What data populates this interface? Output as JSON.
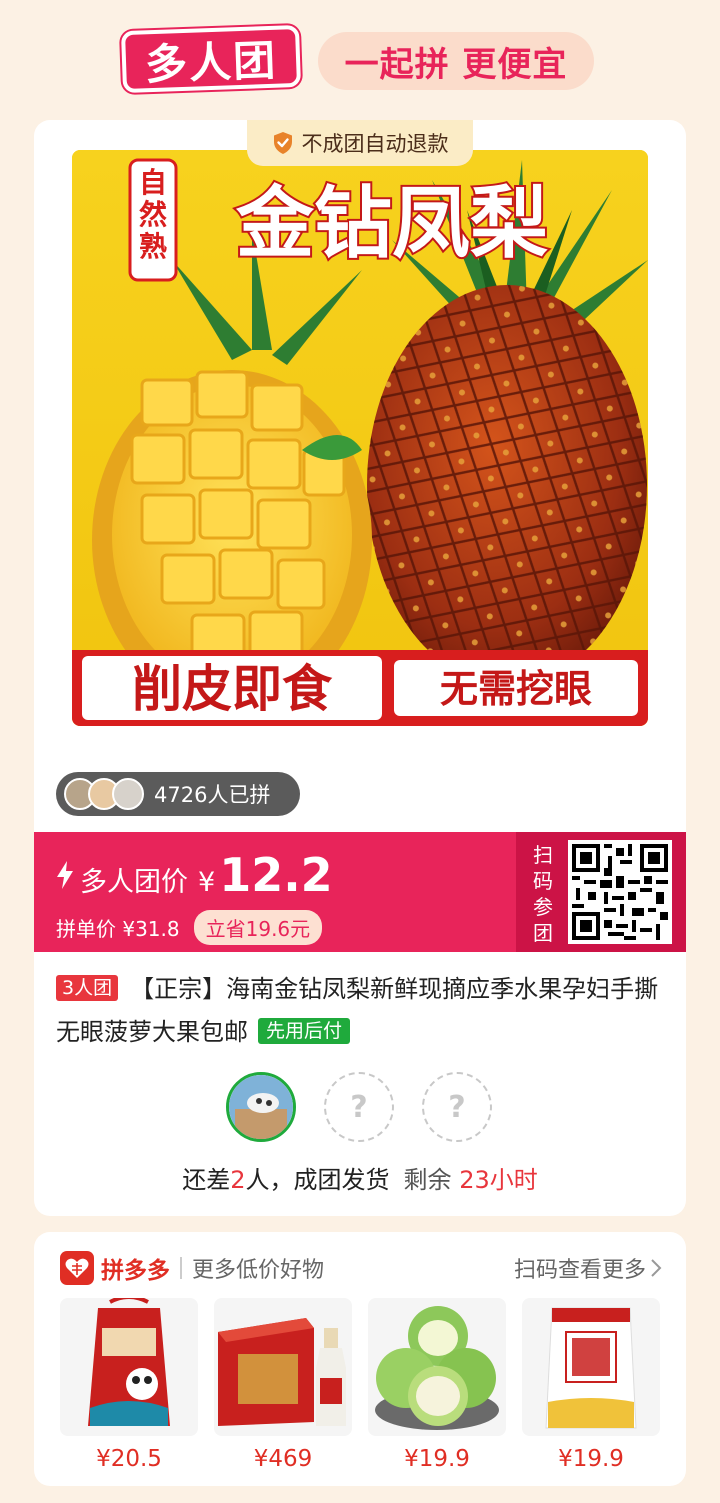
{
  "header": {
    "logo_text": "多人团",
    "slogan": "一起拼 更便宜"
  },
  "card": {
    "refund_badge": "不成团自动退款",
    "product_image": {
      "top_left_text": "自然熟",
      "headline": "金钻凤梨",
      "bottom_left": "削皮即食",
      "bottom_right": "无需挖眼"
    },
    "joined_text": "4726人已拼",
    "price": {
      "label": "多人团价",
      "currency": "¥",
      "value": "12.2",
      "solo_price": "拼单价 ¥31.8",
      "save_badge": "立省19.6元",
      "scan_label": "扫码参团"
    },
    "title": {
      "tag": "3人团",
      "text": "【正宗】海南金钻凤梨新鲜现摘应季水果孕妇手撕无眼菠萝大果包邮",
      "pay_tag": "先用后付"
    },
    "slots": {
      "empty_mark": "?"
    },
    "status": {
      "prefix": "还差",
      "count": "2",
      "suffix": "人，成团发货",
      "remain_label": "剩余",
      "remain_time": "23小时"
    }
  },
  "recommend": {
    "brand": "拼多多",
    "subtitle": "更多低价好物",
    "more": "扫码查看更多",
    "items": [
      {
        "price": "¥20.5"
      },
      {
        "price": "¥469"
      },
      {
        "price": "¥19.9"
      },
      {
        "price": "¥19.9"
      }
    ]
  },
  "colors": {
    "accent": "#e8245a",
    "dark_accent": "#cc1346",
    "green": "#1faa3c",
    "page_bg": "#fcf1e4"
  },
  "icons": [
    "shield-check-icon",
    "lightning-icon",
    "chevron-right-icon",
    "pinduoduo-logo-icon",
    "qr-code-icon"
  ]
}
